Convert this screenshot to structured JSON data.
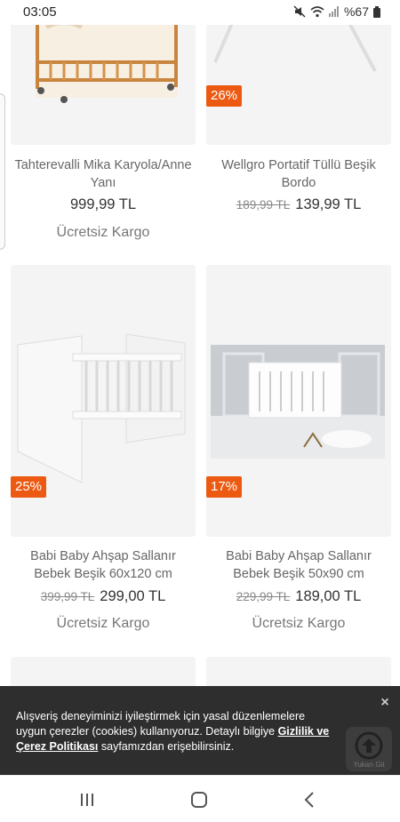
{
  "status_bar": {
    "time": "03:05",
    "battery": "%67"
  },
  "products": [
    {
      "name": "Tahterevalli Mika Karyola/Anne Yanı",
      "old_price": "",
      "price": "999,99 TL",
      "shipping": "Ücretsiz Kargo",
      "discount": ""
    },
    {
      "name": "Wellgro Portatif Tüllü Beşik Bordo",
      "old_price": "189,99 TL",
      "price": "139,99 TL",
      "shipping": "",
      "discount": "26%"
    },
    {
      "name": "Babi Baby Ahşap Sallanır Bebek Beşik 60x120 cm",
      "old_price": "399,99 TL",
      "price": "299,00 TL",
      "shipping": "Ücretsiz Kargo",
      "discount": "25%"
    },
    {
      "name": "Babi Baby Ahşap Sallanır Bebek Beşik 50x90 cm",
      "old_price": "229,99 TL",
      "price": "189,00 TL",
      "shipping": "Ücretsiz Kargo",
      "discount": "17%"
    }
  ],
  "cookie_banner": {
    "text_before": "Alışveriş deneyiminizi iyileştirmek için yasal düzenlemelere uygun çerezler (cookies) kullanıyoruz. Detaylı bilgiye ",
    "link": "Gizlilik ve Çerez Politikası",
    "text_after": " sayfamızdan erişebilirsiniz.",
    "close_label": "×"
  },
  "back_to_top": {
    "label": "Yukarı Git"
  },
  "colors": {
    "discount": "#ec5a12",
    "card_bg": "#f4f4f4",
    "banner_bg": "#1e1e1e"
  },
  "nav": {
    "icons": [
      "recent-apps-icon",
      "home-icon",
      "back-icon"
    ]
  }
}
